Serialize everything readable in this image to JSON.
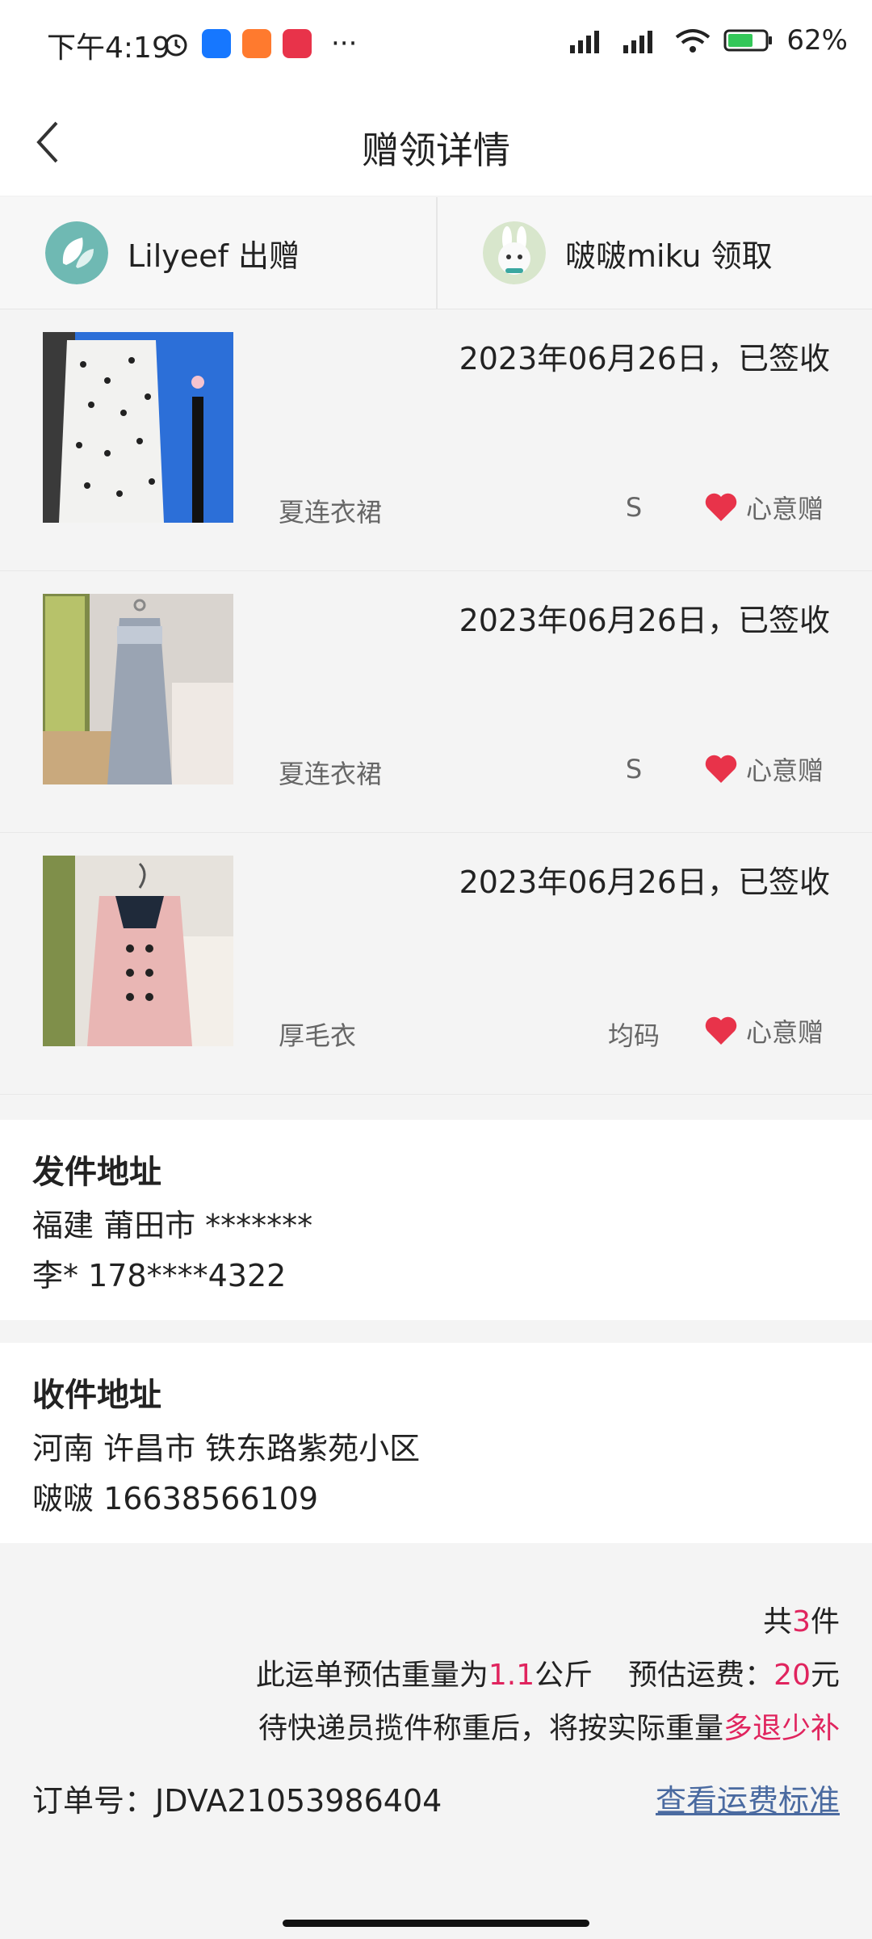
{
  "status_bar": {
    "time": "下午4:19",
    "battery": "62%"
  },
  "header": {
    "title": "赠领详情"
  },
  "giver": {
    "label": "Lilyeef 出赠"
  },
  "receiver": {
    "label": "啵啵miku 领取"
  },
  "items": [
    {
      "date_status": "2023年06月26日，已签收",
      "name": "夏连衣裙",
      "size": "S",
      "tag": "心意赠"
    },
    {
      "date_status": "2023年06月26日，已签收",
      "name": "夏连衣裙",
      "size": "S",
      "tag": "心意赠"
    },
    {
      "date_status": "2023年06月26日，已签收",
      "name": "厚毛衣",
      "size": "均码",
      "tag": "心意赠"
    }
  ],
  "sender_address": {
    "title": "发件地址",
    "line1": "福建 莆田市 *******",
    "line2": "李* 178****4322"
  },
  "receiver_address": {
    "title": "收件地址",
    "line1": "河南 许昌市 铁东路紫苑小区",
    "line2": "啵啵 16638566109"
  },
  "summary": {
    "count_prefix": "共",
    "count": "3",
    "count_suffix": "件",
    "weight_prefix": "此运单预估重量为",
    "weight": "1.1",
    "weight_unit": "公斤",
    "fee_prefix": "预估运费：",
    "fee": "20",
    "fee_unit": "元",
    "notice_prefix": "待快递员揽件称重后，将按实际重量",
    "notice_highlight": "多退少补",
    "order_label": "订单号：JDVA21053986404",
    "fee_standard_link": "查看运费标准"
  },
  "colors": {
    "accent_red": "#e0245e",
    "link_blue": "#4a6aa0",
    "heart": "#e8334a"
  }
}
